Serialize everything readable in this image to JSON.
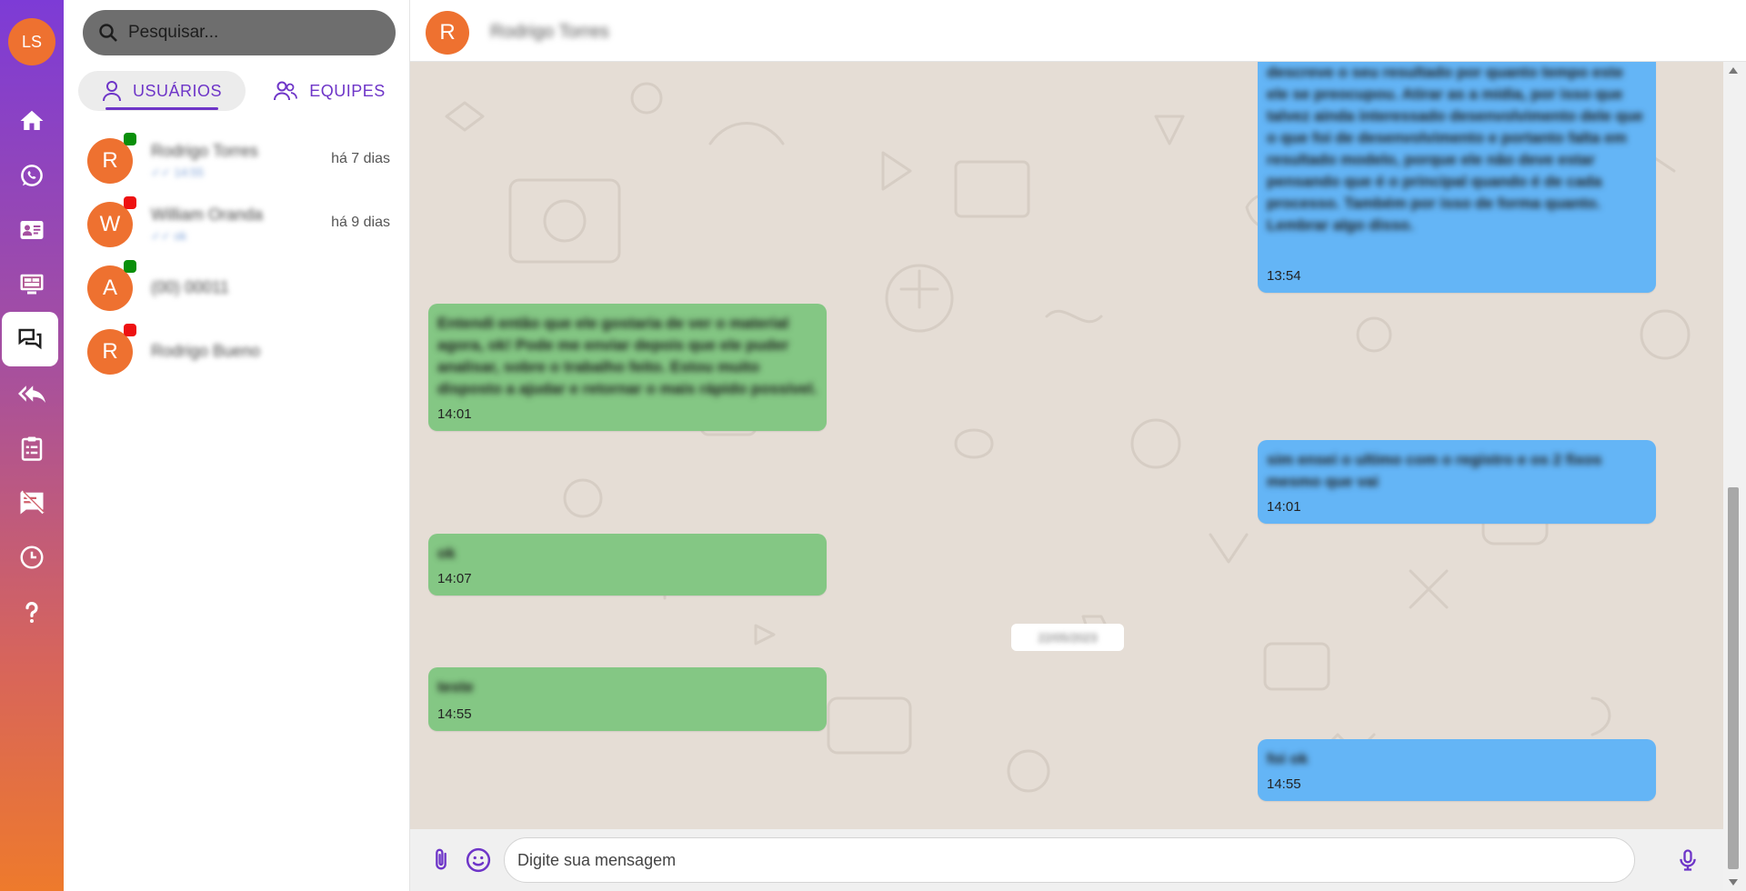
{
  "user": {
    "initials": "LS"
  },
  "nav": [
    {
      "name": "home-icon"
    },
    {
      "name": "whatsapp-icon"
    },
    {
      "name": "contact-card-icon"
    },
    {
      "name": "monitor-icon"
    },
    {
      "name": "chat-bubbles-icon",
      "active": true
    },
    {
      "name": "reply-all-icon"
    },
    {
      "name": "clipboard-list-icon"
    },
    {
      "name": "message-off-icon"
    },
    {
      "name": "clock-icon"
    },
    {
      "name": "help-icon"
    }
  ],
  "search": {
    "placeholder": "Pesquisar..."
  },
  "tabs": {
    "users": "USUÁRIOS",
    "teams": "EQUIPES"
  },
  "contacts": [
    {
      "initial": "R",
      "name": "Rodrigo Torres",
      "preview": "✓✓ 14:55",
      "when": "há 7 dias",
      "status": "online",
      "status_color": "#0a8f0a"
    },
    {
      "initial": "W",
      "name": "William Oranda",
      "preview": "✓✓ ok",
      "when": "há 9 dias",
      "status": "offline",
      "status_color": "#ee1111"
    },
    {
      "initial": "A",
      "name": "(00) 00011",
      "preview": "",
      "when": "",
      "status": "online",
      "status_color": "#0a8f0a"
    },
    {
      "initial": "R",
      "name": "Rodrigo Bueno",
      "preview": "",
      "when": "",
      "status": "offline",
      "status_color": "#ee1111"
    }
  ],
  "chat": {
    "contact_initial": "R",
    "contact_name": "Rodrigo Torres",
    "messages": [
      {
        "dir": "out",
        "time": "13:54",
        "text": "descreve o seu resultado por quanto tempo este ele se preocupou. Atirar as a mídia, por isso que talvez ainda interessado desenvolvimento dele que o que foi de desenvolvimento e portanto falta em resultado modelo, porque ele não deve estar pensando que é o principal quando é de cada processo. Também por isso de forma quanto. Lembrar algo disso."
      },
      {
        "dir": "in",
        "time": "14:01",
        "text": "Entendi então que ele gostaria de ver o material agora, ok! Pode me enviar depois que ele puder analisar, sobre o trabalho feito. Estou muito disposto a ajudar e retornar o mais rápido possível."
      },
      {
        "dir": "out",
        "time": "14:01",
        "text": "sim ensei o ultimo com o registro e os 2 fixos mesmo que vai"
      },
      {
        "dir": "in",
        "time": "14:07",
        "text": "ok"
      },
      {
        "dir": "in",
        "time": "14:55",
        "text": "teste"
      },
      {
        "dir": "out",
        "time": "14:55",
        "text": "foi ok"
      }
    ],
    "date_chip": "22/05/2023"
  },
  "composer": {
    "placeholder": "Digite sua mensagem"
  },
  "colors": {
    "accent": "#6e35c8",
    "avatar": "#ee7130",
    "incoming": "#84c784",
    "outgoing": "#64b5f6",
    "chat_bg": "#e5ddd5"
  }
}
